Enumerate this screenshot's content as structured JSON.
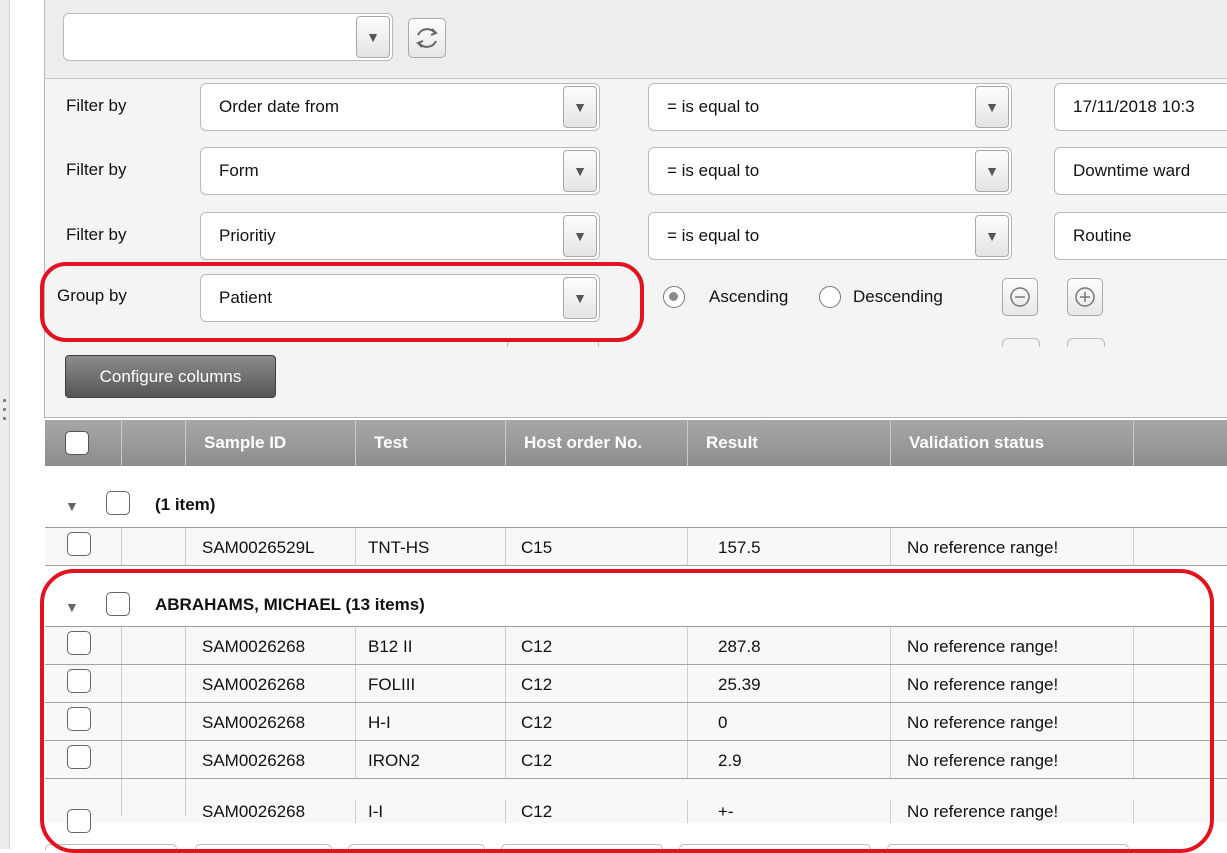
{
  "toolbar": {
    "view_select": {
      "value": ""
    },
    "dropdown_arrow": "▼",
    "refresh_icon": "refresh-icon"
  },
  "filters": [
    {
      "label": "Filter by",
      "field": "Order date from",
      "operator": "= is equal to",
      "value": "17/11/2018 10:3"
    },
    {
      "label": "Filter by",
      "field": "Form",
      "operator": "= is equal to",
      "value": "Downtime ward"
    },
    {
      "label": "Filter by",
      "field": "Prioritiy",
      "operator": "= is equal to",
      "value": "Routine"
    }
  ],
  "group_by": {
    "label": "Group by",
    "field": "Patient",
    "ascending_label": "Ascending",
    "descending_label": "Descending",
    "selected": "Ascending"
  },
  "configure_columns_label": "Configure columns",
  "grid": {
    "columns": [
      "",
      "",
      "Sample ID",
      "Test",
      "Host order No.",
      "Result",
      "Validation status",
      ""
    ],
    "groups": [
      {
        "title": "(1 item)",
        "rows": [
          {
            "sample_id": "SAM0026529L",
            "test": "TNT-HS",
            "host_order": "C15",
            "result": "157.5",
            "validation": "No reference range!"
          }
        ]
      },
      {
        "title": "ABRAHAMS, MICHAEL (13 items)",
        "rows": [
          {
            "sample_id": "SAM0026268",
            "test": "B12 II",
            "host_order": "C12",
            "result": "287.8",
            "validation": "No reference range!"
          },
          {
            "sample_id": "SAM0026268",
            "test": "FOLIII",
            "host_order": "C12",
            "result": "25.39",
            "validation": "No reference range!"
          },
          {
            "sample_id": "SAM0026268",
            "test": "H-I",
            "host_order": "C12",
            "result": "0",
            "validation": "No reference range!"
          },
          {
            "sample_id": "SAM0026268",
            "test": "IRON2",
            "host_order": "C12",
            "result": "2.9",
            "validation": "No reference range!"
          },
          {
            "sample_id": "SAM0026268",
            "test": "I-I",
            "host_order": "C12",
            "result": "+-",
            "validation": "No reference range!"
          }
        ]
      }
    ]
  },
  "annotation_color": "#e2121f"
}
